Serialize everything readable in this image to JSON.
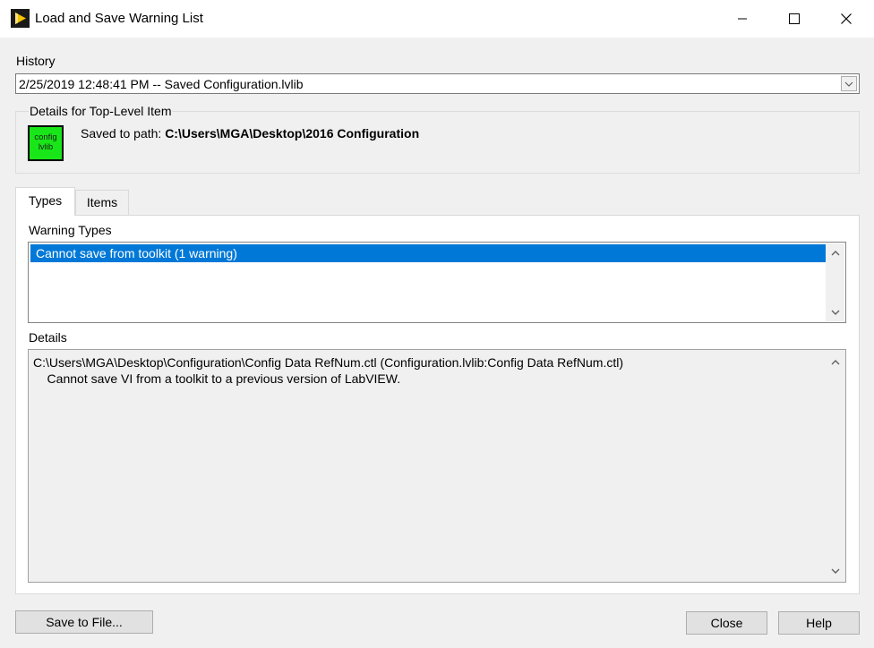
{
  "window": {
    "title": "Load and Save Warning List"
  },
  "history": {
    "label": "History",
    "selected": "2/25/2019 12:48:41 PM -- Saved Configuration.lvlib"
  },
  "top_level": {
    "legend": "Details for Top-Level Item",
    "icon_line1": "config",
    "icon_line2": "lvlib",
    "saved_prefix": "Saved to path: ",
    "saved_path": "C:\\Users\\MGA\\Desktop\\2016 Configuration"
  },
  "tabs": [
    {
      "label": "Types",
      "active": true
    },
    {
      "label": "Items",
      "active": false
    }
  ],
  "warning_types": {
    "label": "Warning Types",
    "items": [
      "Cannot save from toolkit (1 warning)"
    ]
  },
  "details": {
    "label": "Details",
    "line1": "C:\\Users\\MGA\\Desktop\\Configuration\\Config Data RefNum.ctl (Configuration.lvlib:Config Data RefNum.ctl)",
    "line2": "    Cannot save VI from a toolkit to a previous version of LabVIEW."
  },
  "buttons": {
    "save": "Save to File...",
    "close": "Close",
    "help": "Help"
  },
  "colors": {
    "selection": "#0078d7",
    "lvlib_icon": "#19e619",
    "app_icon_arrow": "#f5c400"
  }
}
